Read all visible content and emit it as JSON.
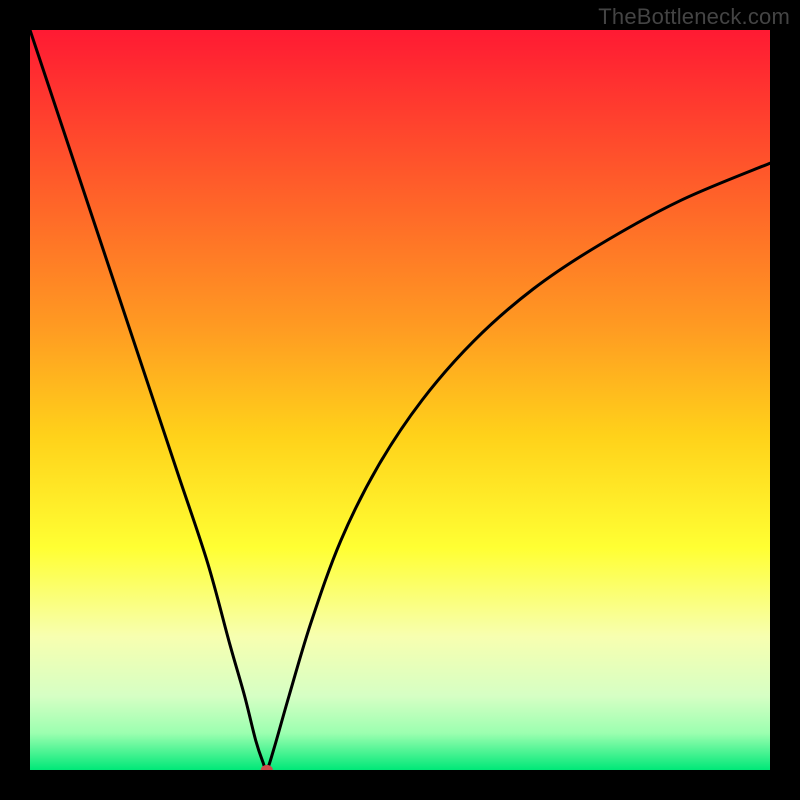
{
  "watermark": "TheBottleneck.com",
  "chart_data": {
    "type": "line",
    "title": "",
    "xlabel": "",
    "ylabel": "",
    "xlim": [
      0,
      100
    ],
    "ylim": [
      0,
      100
    ],
    "grid": false,
    "legend": false,
    "gradient_stops": [
      {
        "offset": 0.0,
        "color": "#ff1a33"
      },
      {
        "offset": 0.2,
        "color": "#ff5a2a"
      },
      {
        "offset": 0.4,
        "color": "#ff9a22"
      },
      {
        "offset": 0.55,
        "color": "#ffd21a"
      },
      {
        "offset": 0.7,
        "color": "#ffff33"
      },
      {
        "offset": 0.82,
        "color": "#f7ffb0"
      },
      {
        "offset": 0.9,
        "color": "#d6ffc4"
      },
      {
        "offset": 0.95,
        "color": "#9cffb0"
      },
      {
        "offset": 1.0,
        "color": "#00e878"
      }
    ],
    "marker": {
      "x": 32,
      "y": 0,
      "color": "#cc4b4b",
      "radius_px": 6
    },
    "series": [
      {
        "name": "bottleneck-curve",
        "x": [
          0,
          4,
          8,
          12,
          16,
          20,
          24,
          27,
          29,
          30.5,
          31.5,
          32,
          33,
          35,
          38,
          42,
          47,
          53,
          60,
          68,
          77,
          88,
          100
        ],
        "y": [
          100,
          88,
          76,
          64,
          52,
          40,
          28,
          17,
          10,
          4,
          1,
          0,
          3,
          10,
          20,
          31,
          41,
          50,
          58,
          65,
          71,
          77,
          82
        ]
      }
    ]
  }
}
